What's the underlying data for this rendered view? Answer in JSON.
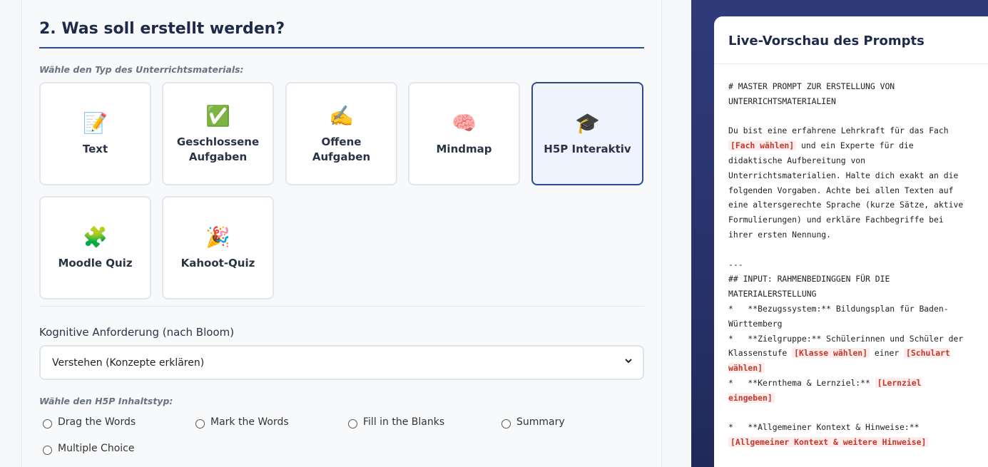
{
  "section": {
    "title": "2. Was soll erstellt werden?",
    "type_hint": "Wähle den Typ des Unterrichtsmaterials:"
  },
  "material_types": [
    {
      "label": "Text",
      "icon": "📝",
      "icon_name": "memo-icon",
      "selected": false
    },
    {
      "label": "Geschlossene Aufgaben",
      "icon": "✅",
      "icon_name": "check-box-icon",
      "selected": false
    },
    {
      "label": "Offene Aufgaben",
      "icon": "✍️",
      "icon_name": "writing-hand-icon",
      "selected": false
    },
    {
      "label": "Mindmap",
      "icon": "🧠",
      "icon_name": "brain-icon",
      "selected": false
    },
    {
      "label": "H5P Interaktiv",
      "icon": "🎓",
      "icon_name": "graduation-cap-icon",
      "selected": true
    },
    {
      "label": "Moodle Quiz",
      "icon": "🧩",
      "icon_name": "puzzle-icon",
      "selected": false
    },
    {
      "label": "Kahoot-Quiz",
      "icon": "🎉",
      "icon_name": "party-popper-icon",
      "selected": false
    }
  ],
  "bloom": {
    "label": "Kognitive Anforderung (nach Bloom)",
    "selected": "Verstehen (Konzepte erklären)"
  },
  "h5p": {
    "hint": "Wähle den H5P Inhaltstyp:",
    "options": [
      "Drag the Words",
      "Mark the Words",
      "Fill in the Blanks",
      "Summary",
      "Multiple Choice"
    ]
  },
  "preview": {
    "title": "Live-Vorschau des Prompts",
    "lines": [
      [
        {
          "t": "# MASTER PROMPT ZUR ERSTELLUNG VON\nUNTERRICHTSMATERIALIEN\n\nDu bist eine erfahrene Lehrkraft für das Fach\n"
        },
        {
          "t": "[Fach wählen]",
          "ph": true
        },
        {
          "t": " und ein Experte für die\ndidaktische Aufbereitung von\nUnterrichtsmaterialien. Halte dich exakt an die\nfolgenden Vorgaben. Achte bei allen Texten auf\neine altersgerechte Sprache (kurze Sätze, aktive\nFormulierungen) und erkläre Fachbegriffe bei\nihrer ersten Nennung.\n\n---\n## INPUT: RAHMENBEDINGGEN FÜR DIE\nMATERIALERSTELLUNG\n*   **Bezugssystem:** Bildungsplan für Baden-\nWürttemberg\n*   **Zielgruppe:** Schülerinnen und Schüler der\nKlassenstufe "
        },
        {
          "t": "[Klasse wählen]",
          "ph": true
        },
        {
          "t": " einer "
        },
        {
          "t": "[Schulart\nwählen]",
          "ph": true
        },
        {
          "t": "\n*   **Kernthema & Lernziel:** "
        },
        {
          "t": "[Lernziel\neingeben]",
          "ph": true
        },
        {
          "t": "\n\n*   **Allgemeiner Kontext & Hinweise:**\n"
        },
        {
          "t": "[Allgemeiner Kontext & weitere Hinweise]",
          "ph": true
        }
      ]
    ]
  }
}
